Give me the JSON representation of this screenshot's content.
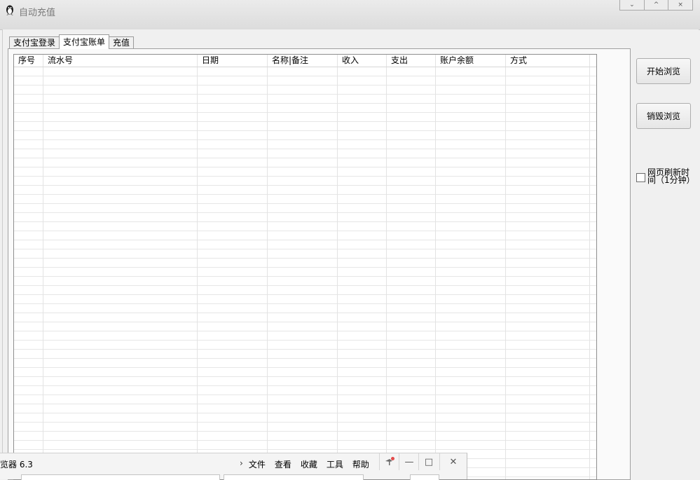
{
  "window": {
    "title": "自动充值",
    "controls": {
      "minimize": "⌄",
      "maximize": "^",
      "close": "×"
    }
  },
  "tabs": [
    {
      "label": "支付宝登录"
    },
    {
      "label": "支付宝账单"
    },
    {
      "label": "充值"
    }
  ],
  "active_tab": 1,
  "table": {
    "columns": [
      "序号",
      "流水号",
      "日期",
      "名称|备注",
      "收入",
      "支出",
      "账户余额",
      "方式"
    ],
    "rows": []
  },
  "side": {
    "start_button": "开始浏览",
    "destroy_button": "销毁浏览",
    "refresh_checkbox_label": "网页刷新时间（1分钟）",
    "refresh_checked": false
  },
  "browser": {
    "title": "览器 6.3",
    "chevron": "›",
    "menu": [
      "文件",
      "查看",
      "收藏",
      "工具",
      "帮助"
    ],
    "controls": {
      "pin": "📌",
      "minimize": "—",
      "maximize": "□",
      "close": "✕"
    }
  },
  "colors": {
    "title_text": "#7a7a7a",
    "grid_line": "#e6e6e6",
    "accent_pin": "#e34a4a"
  }
}
